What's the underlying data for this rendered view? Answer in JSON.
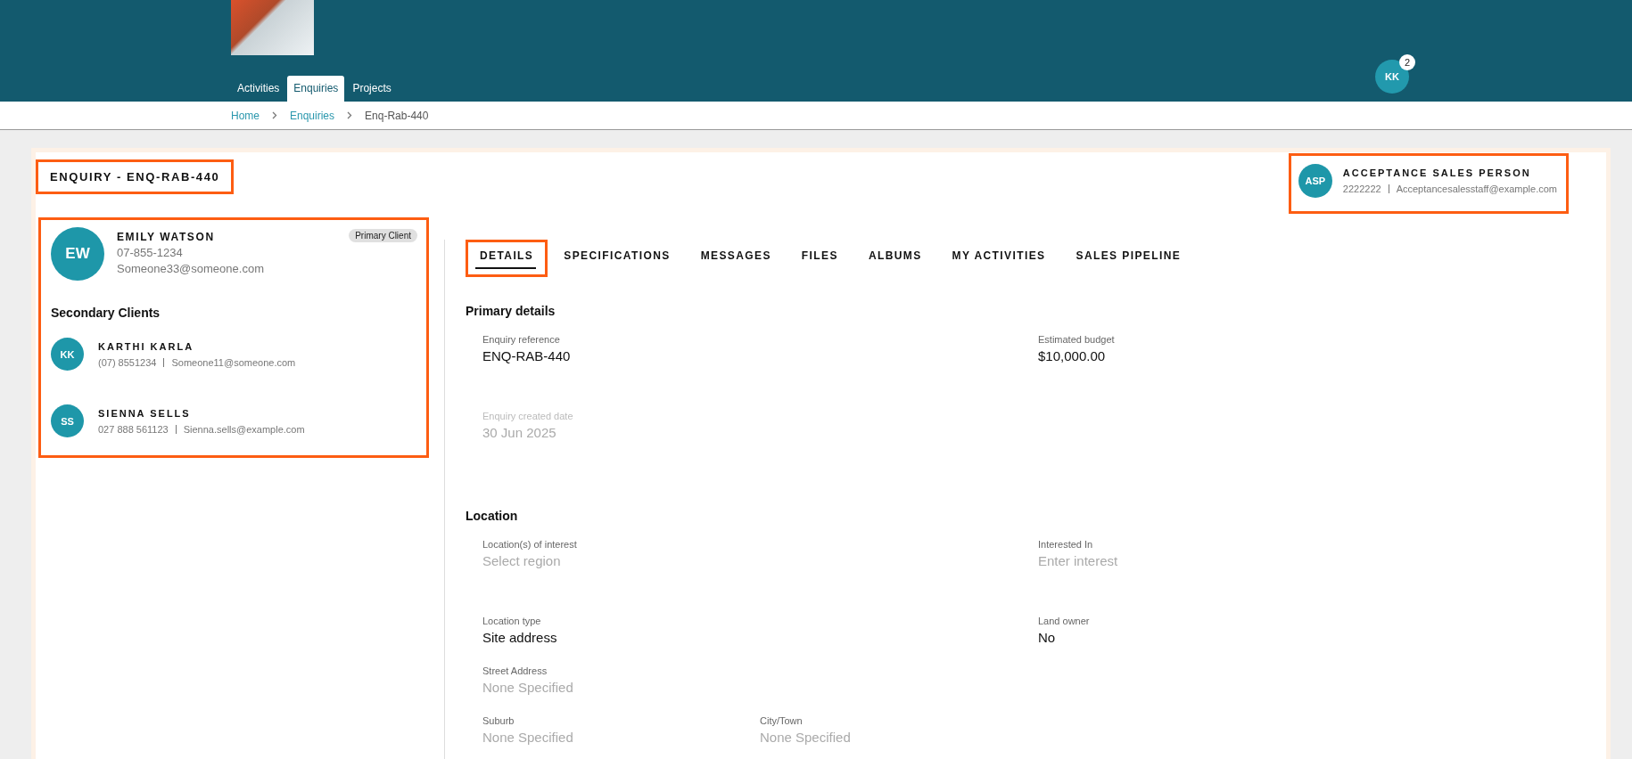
{
  "header": {
    "nav": [
      {
        "label": "Activities",
        "selected": false
      },
      {
        "label": "Enquiries",
        "selected": true
      },
      {
        "label": "Projects",
        "selected": false
      }
    ],
    "user": {
      "initials": "KK",
      "badge": "2"
    }
  },
  "breadcrumb": [
    {
      "label": "Home",
      "current": false
    },
    {
      "label": "Enquiries",
      "current": false
    },
    {
      "label": "Enq-Rab-440",
      "current": true
    }
  ],
  "page_title": {
    "text": "ENQUIRY - ENQ-RAB-440",
    "highlighted": true
  },
  "sales_person": {
    "initials": "ASP",
    "name": "ACCEPTANCE SALES PERSON",
    "phone": "2222222",
    "email": "Acceptancesalesstaff@example.com",
    "highlighted": true
  },
  "clients": {
    "highlighted": true,
    "primary": {
      "initials": "EW",
      "name": "EMILY WATSON",
      "phone": "07-855-1234",
      "email": "Someone33@someone.com",
      "badge": "Primary Client"
    },
    "secondary_heading": "Secondary Clients",
    "secondary": [
      {
        "initials": "KK",
        "name": "KARTHI KARLA",
        "phone": "(07) 8551234",
        "email": "Someone11@someone.com"
      },
      {
        "initials": "SS",
        "name": "SIENNA SELLS",
        "phone": "027 888 561123",
        "email": "Sienna.sells@example.com"
      }
    ]
  },
  "tabs": [
    {
      "label": "DETAILS",
      "selected": true,
      "highlighted": true
    },
    {
      "label": "SPECIFICATIONS",
      "selected": false,
      "highlighted": false
    },
    {
      "label": "MESSAGES",
      "selected": false,
      "highlighted": false
    },
    {
      "label": "FILES",
      "selected": false,
      "highlighted": false
    },
    {
      "label": "ALBUMS",
      "selected": false,
      "highlighted": false
    },
    {
      "label": "MY ACTIVITIES",
      "selected": false,
      "highlighted": false
    },
    {
      "label": "SALES PIPELINE",
      "selected": false,
      "highlighted": false
    }
  ],
  "sections": [
    {
      "heading": "Primary details",
      "rows": [
        [
          {
            "label": "Enquiry reference",
            "value": "ENQ-RAB-440",
            "disabled": false
          },
          {
            "label": "Estimated budget",
            "value": "$10,000.00",
            "disabled": false
          }
        ],
        [
          {
            "label": "Enquiry created date",
            "value": "30 Jun 2025",
            "disabled": true
          }
        ]
      ]
    },
    {
      "heading": "Location",
      "rows": [
        [
          {
            "label": "Location(s) of interest",
            "placeholder": "Select region",
            "disabled": false
          },
          {
            "label": "Interested In",
            "placeholder": "Enter interest",
            "disabled": false
          }
        ],
        [
          {
            "label": "Location type",
            "value": "Site address",
            "disabled": false
          },
          {
            "label": "Land owner",
            "value": "No",
            "disabled": false
          }
        ],
        [
          {
            "label": "Street Address",
            "placeholder": "None Specified",
            "disabled": false
          }
        ],
        [
          {
            "label": "Suburb",
            "placeholder": "None Specified",
            "disabled": false
          },
          {
            "label": "City/Town",
            "placeholder": "None Specified",
            "disabled": false
          },
          null
        ]
      ]
    }
  ]
}
